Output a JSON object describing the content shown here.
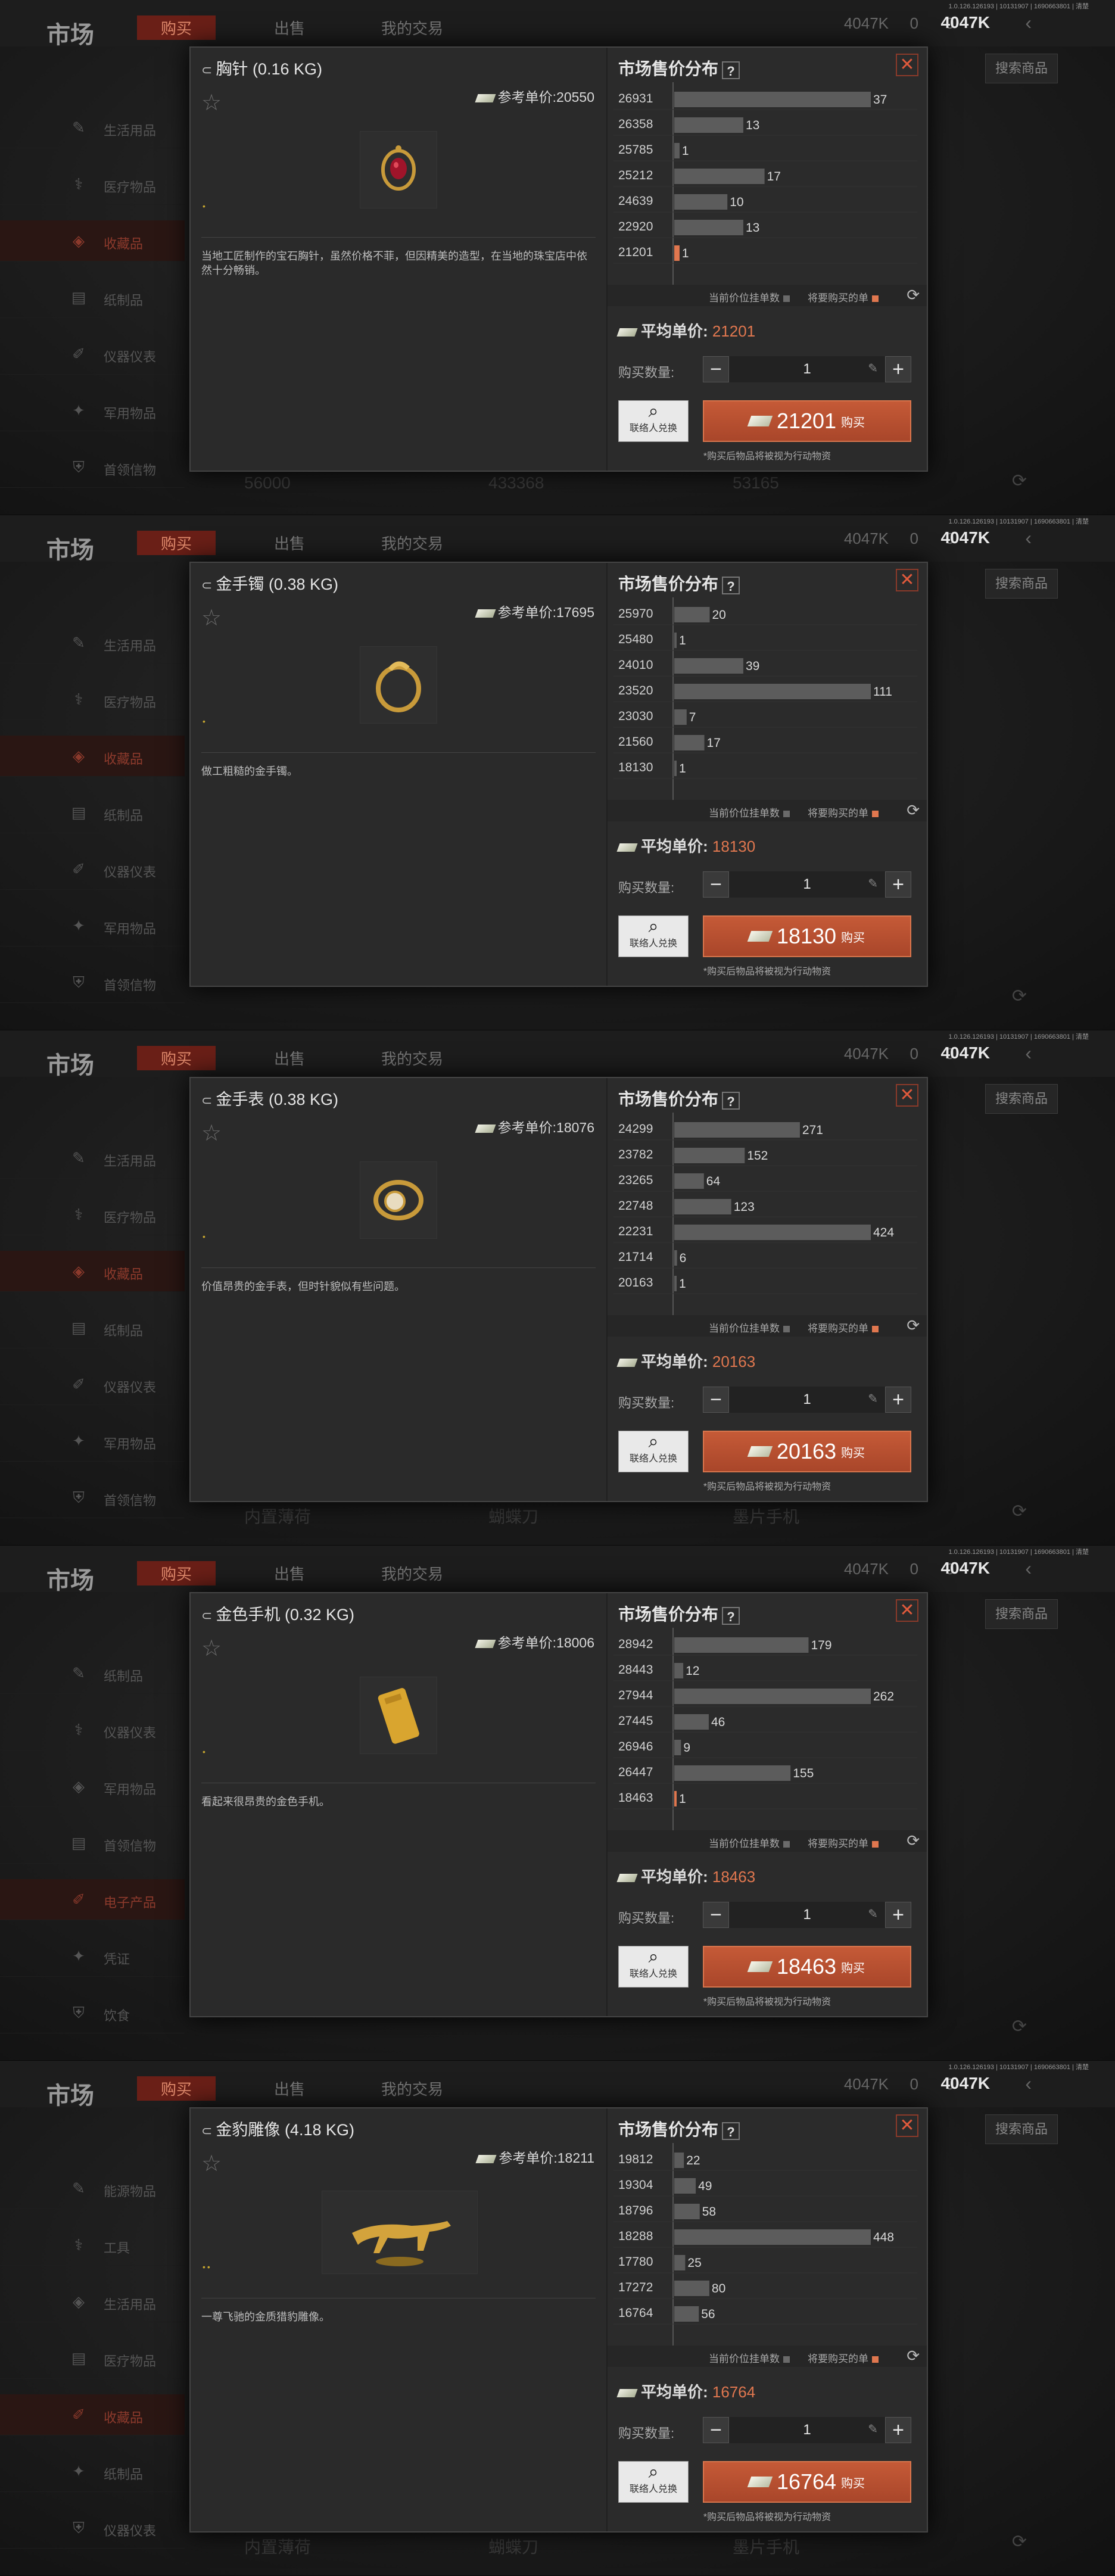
{
  "app": {
    "title": "市场",
    "tabs": [
      "购买",
      "出售",
      "我的交易"
    ],
    "version": "1.0.126.126193 | 10131907 | 1690663801 | 清楚",
    "money": "4047K",
    "res1": "4047K",
    "res2": "0",
    "res3": "0",
    "search_label": "搜索商品",
    "colors": {
      "accent": "#e0774f",
      "button": "#b44e2f",
      "bar": "#5a5a5a"
    }
  },
  "common": {
    "market_title": "市场售价分布",
    "qmark": "?",
    "close": "✕",
    "legend_current": "当前价位挂单数",
    "legend_buy": "将要购买的单",
    "avg_label": "平均单价: ",
    "qty_label": "购买数量:",
    "ref_label": "参考单价:",
    "exchange_label": "联络人兑换",
    "buy_label": "购买",
    "note": "*购买后物品将被视为行动物资"
  },
  "panels": [
    {
      "bg": {
        "sidebar": [
          "生活用品",
          "医疗物品",
          "收藏品",
          "纸制品",
          "仪器仪表",
          "军用物品",
          "首领信物"
        ],
        "active_index": 2,
        "bottom": [
          "56000",
          "433368",
          "53165"
        ]
      },
      "item": {
        "name": "胸针 (0.16 KG)",
        "ref_price": "20550",
        "desc": "当地工匠制作的宝石胸针，虽然价格不菲，但因精美的造型，在当地的珠宝店中依然十分畅销。",
        "image_icon": "brooch-icon",
        "dots": "•"
      },
      "chart_data": {
        "type": "bar",
        "orientation": "horizontal",
        "categories": [
          "26931",
          "26358",
          "25785",
          "25212",
          "24639",
          "22920",
          "21201"
        ],
        "values": [
          37,
          13,
          1,
          17,
          10,
          13,
          1
        ],
        "highlight_index": 6
      },
      "avg_price": "21201",
      "qty": "1",
      "buy_price": "21201"
    },
    {
      "bg": {
        "sidebar": [
          "生活用品",
          "医疗物品",
          "收藏品",
          "纸制品",
          "仪器仪表",
          "军用物品",
          "首领信物"
        ],
        "active_index": 2,
        "bottom": []
      },
      "item": {
        "name": "金手镯 (0.38 KG)",
        "ref_price": "17695",
        "desc": "做工粗糙的金手镯。",
        "image_icon": "bracelet-icon",
        "dots": "•"
      },
      "chart_data": {
        "type": "bar",
        "orientation": "horizontal",
        "categories": [
          "25970",
          "25480",
          "24010",
          "23520",
          "23030",
          "21560",
          "18130"
        ],
        "values": [
          20,
          1,
          39,
          111,
          7,
          17,
          1
        ],
        "highlight_index": -1
      },
      "avg_price": "18130",
      "qty": "1",
      "buy_price": "18130"
    },
    {
      "bg": {
        "sidebar": [
          "生活用品",
          "医疗物品",
          "收藏品",
          "纸制品",
          "仪器仪表",
          "军用物品",
          "首领信物"
        ],
        "active_index": 2,
        "bottom": [
          "内置薄荷",
          "蝴蝶刀",
          "墨片手机"
        ]
      },
      "item": {
        "name": "金手表 (0.38 KG)",
        "ref_price": "18076",
        "desc": "价值昂贵的金手表，但时针貌似有些问题。",
        "image_icon": "watch-icon",
        "dots": "•"
      },
      "chart_data": {
        "type": "bar",
        "orientation": "horizontal",
        "categories": [
          "24299",
          "23782",
          "23265",
          "22748",
          "22231",
          "21714",
          "20163"
        ],
        "values": [
          271,
          152,
          64,
          123,
          424,
          6,
          1
        ],
        "highlight_index": -1
      },
      "avg_price": "20163",
      "qty": "1",
      "buy_price": "20163"
    },
    {
      "bg": {
        "sidebar": [
          "纸制品",
          "仪器仪表",
          "军用物品",
          "首领信物",
          "电子产品",
          "凭证",
          "饮食"
        ],
        "active_index": 4,
        "bottom": []
      },
      "item": {
        "name": "金色手机 (0.32 KG)",
        "ref_price": "18006",
        "desc": "看起来很昂贵的金色手机。",
        "image_icon": "phone-icon",
        "dots": "•"
      },
      "chart_data": {
        "type": "bar",
        "orientation": "horizontal",
        "categories": [
          "28942",
          "28443",
          "27944",
          "27445",
          "26946",
          "26447",
          "18463"
        ],
        "values": [
          179,
          12,
          262,
          46,
          9,
          155,
          1
        ],
        "highlight_index": 6
      },
      "avg_price": "18463",
      "qty": "1",
      "buy_price": "18463"
    },
    {
      "bg": {
        "sidebar": [
          "能源物品",
          "工具",
          "生活用品",
          "医疗物品",
          "收藏品",
          "纸制品",
          "仪器仪表"
        ],
        "active_index": 4,
        "bottom": [
          "内置薄荷",
          "蝴蝶刀",
          "墨片手机"
        ]
      },
      "item": {
        "name": "金豹雕像 (4.18 KG)",
        "ref_price": "18211",
        "desc": "一尊飞驰的金质猎豹雕像。",
        "image_icon": "leopard-statue-icon",
        "dots": "••"
      },
      "chart_data": {
        "type": "bar",
        "orientation": "horizontal",
        "categories": [
          "19812",
          "19304",
          "18796",
          "18288",
          "17780",
          "17272",
          "16764"
        ],
        "values": [
          22,
          49,
          58,
          448,
          25,
          80,
          56
        ],
        "highlight_index": -1
      },
      "avg_price": "16764",
      "qty": "1",
      "buy_price": "16764"
    }
  ]
}
